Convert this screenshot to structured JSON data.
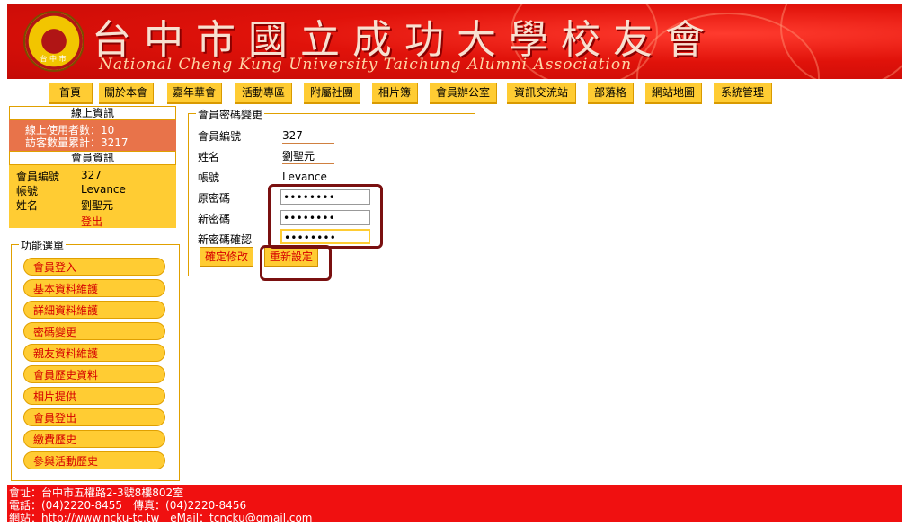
{
  "header": {
    "title_zh": "台中市國立成功大學校友會",
    "title_en": "National Cheng Kung University Taichung Alumni Association",
    "logo_text": "台 中 市"
  },
  "nav": [
    "首頁",
    "關於本會",
    "嘉年華會",
    "活動專區",
    "附屬社團",
    "相片簿",
    "會員辦公室",
    "資訊交流站",
    "部落格",
    "網站地圖",
    "系統管理"
  ],
  "online": {
    "heading": "線上資訊",
    "users_label": "線上使用者數：",
    "users_value": "10",
    "visitors_label": "訪客數量累計：",
    "visitors_value": "3217"
  },
  "member": {
    "heading": "會員資訊",
    "id_label": "會員編號",
    "id_value": "327",
    "account_label": "帳號",
    "account_value": "Levance",
    "name_label": "姓名",
    "name_value": "劉聖元",
    "logout": "登出"
  },
  "menu": {
    "legend": "功能選單",
    "items": [
      "會員登入",
      "基本資料維護",
      "詳細資料維護",
      "密碼變更",
      "親友資料維護",
      "會員歷史資料",
      "相片提供",
      "會員登出",
      "繳費歷史",
      "參與活動歷史"
    ]
  },
  "form": {
    "legend": "會員密碼變更",
    "fields": [
      {
        "label": "會員編號",
        "value": "327"
      },
      {
        "label": "姓名",
        "value": "劉聖元"
      },
      {
        "label": "帳號",
        "value": "Levance"
      },
      {
        "label": "原密碼",
        "value": "••••••••"
      },
      {
        "label": "新密碼",
        "value": "••••••••"
      },
      {
        "label": "新密碼確認",
        "value": "••••••••"
      }
    ],
    "confirm_button": "確定修改",
    "reset_button": "重新設定"
  },
  "footer": {
    "address": "會址：台中市五權路2-3號8樓802室",
    "phone": "電話：(04)2220-8455　傳真：(04)2220-8456",
    "web": "網站：http://www.ncku-tc.tw　eMail：tcncku@gmail.com"
  },
  "colors": {
    "banner_red": "#e0120a",
    "nav_yellow": "#ffcc33",
    "online_orange": "#e8734a",
    "footer_red": "#f01010",
    "link_red": "#d60000",
    "annotation_maroon": "#7a1010"
  }
}
